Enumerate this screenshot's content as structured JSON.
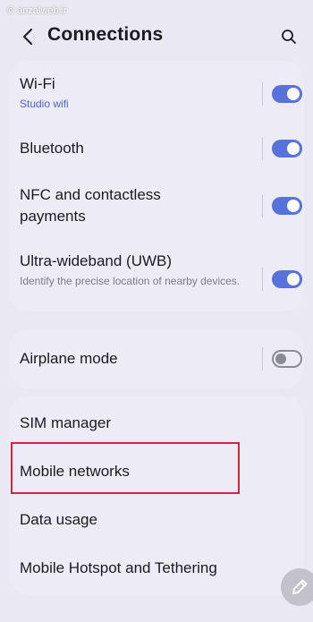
{
  "watermark": "© anzalweb.ir",
  "header": {
    "title": "Connections"
  },
  "group1": [
    {
      "label": "Wi-Fi",
      "sub": "Studio wifi",
      "toggle": "on"
    },
    {
      "label": "Bluetooth",
      "toggle": "on"
    },
    {
      "label": "NFC and contactless payments",
      "toggle": "on"
    },
    {
      "label": "Ultra-wideband (UWB)",
      "sub": "Identify the precise location of nearby devices.",
      "toggle": "on"
    }
  ],
  "group2": [
    {
      "label": "Airplane mode",
      "toggle": "off"
    }
  ],
  "group3": [
    {
      "label": "SIM manager"
    },
    {
      "label": "Mobile networks"
    },
    {
      "label": "Data usage"
    },
    {
      "label": "Mobile Hotspot and Tethering"
    }
  ],
  "colors": {
    "accent": "#5872dc",
    "background": "#e9e8f3",
    "highlight": "#d0283a"
  },
  "icons": {
    "back": "chevron-left-icon",
    "search": "search-icon",
    "fab": "pencil-icon"
  }
}
